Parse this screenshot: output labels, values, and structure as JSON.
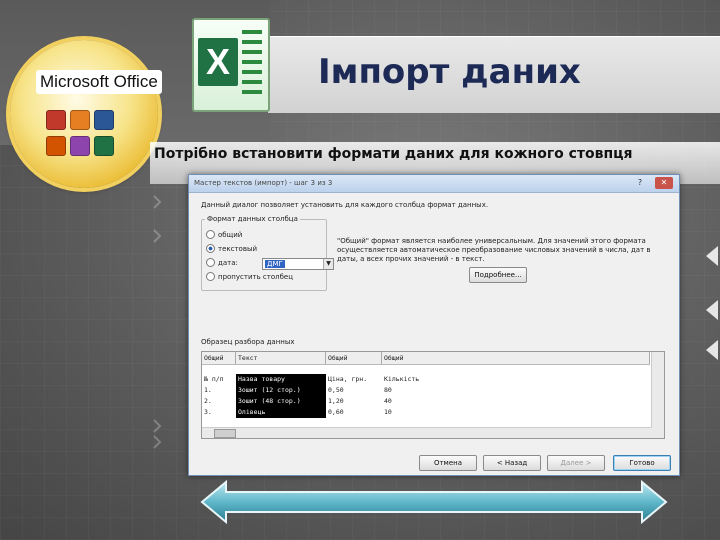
{
  "slide": {
    "title": "Імпорт даних",
    "subtitle": "Потрібно встановити формати даних для кожного стовпця"
  },
  "badge": {
    "label": "Microsoft Office"
  },
  "logo": {
    "letter": "X"
  },
  "dialog": {
    "title": "Мастер текстов (импорт) - шаг 3 из 3",
    "description": "Данный диалог позволяет установить для каждого столбца формат данных.",
    "group_title": "Формат данных столбца",
    "options": [
      {
        "label": "общий",
        "checked": false
      },
      {
        "label": "текстовый",
        "checked": true
      },
      {
        "label": "дата:",
        "checked": false
      },
      {
        "label": "пропустить столбец",
        "checked": false
      }
    ],
    "date_value": "ДМГ",
    "info": "\"Общий\" формат является наиболее универсальным. Для значений этого формата осуществляется автоматическое преобразование числовых значений в числа, дат в даты, а всех прочих значений - в текст.",
    "more_button": "Подробнее...",
    "preview_label": "Образец разбора данных",
    "preview_headers": [
      "Общий",
      "Текст",
      "Общий",
      "Общий"
    ],
    "preview_rows": [
      [
        "№ п/п",
        "Назва товару",
        "Ціна, грн.",
        "Кількість"
      ],
      [
        "1.",
        "Зошит (12 стор.)",
        "0,50",
        "80"
      ],
      [
        "2.",
        "Зошит (48 стор.)",
        "1,20",
        "40"
      ],
      [
        "3.",
        "Олівець",
        "0,60",
        "10"
      ]
    ],
    "buttons": {
      "cancel": "Отмена",
      "back": "< Назад",
      "next": "Далее >",
      "finish": "Готово"
    }
  },
  "colors": {
    "title": "#1c2a55",
    "excel_green": "#207245",
    "arrow": "#5fb7c9"
  }
}
